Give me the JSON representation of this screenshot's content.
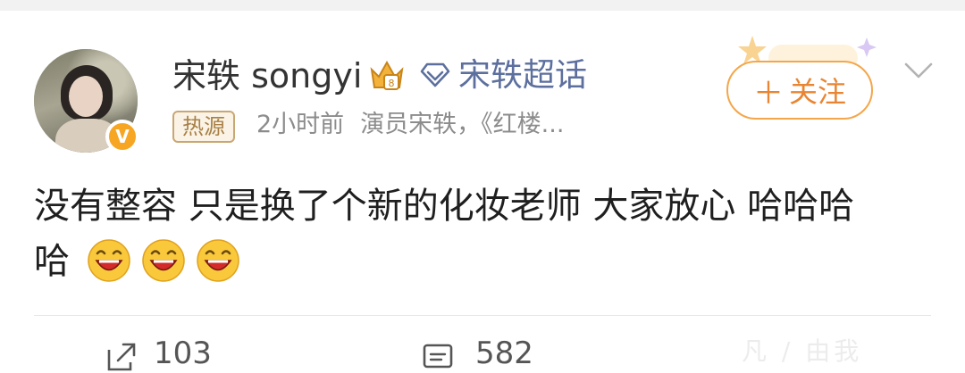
{
  "post": {
    "author": {
      "name": "宋轶 songyi",
      "avatar_icon": "avatar-photo",
      "verified_badge": "V",
      "crown_icon": "vip-crown-icon",
      "supertopic_icon": "diamond-icon",
      "supertopic_label": "宋轶超话"
    },
    "meta": {
      "source_tag": "热源",
      "time": "2小时前",
      "description": "演员宋轶，《红楼..."
    },
    "follow_button": {
      "label": "关注",
      "plus": "＋"
    },
    "text_lines": [
      "没有整容 只是换了个新的化妆老师 大家放心 哈哈哈",
      "哈"
    ],
    "emoji_icon": "laughing-emoji-icon",
    "emoji_count": 3
  },
  "actions": {
    "repost": {
      "icon": "share-icon",
      "count": "103"
    },
    "comment": {
      "icon": "comment-icon",
      "count": "582"
    }
  },
  "watermark": "凡 / 由我",
  "colors": {
    "follow_accent": "#f4a64a",
    "supertopic_blue": "#5c6f9e",
    "verified_orange": "#f6a623"
  }
}
